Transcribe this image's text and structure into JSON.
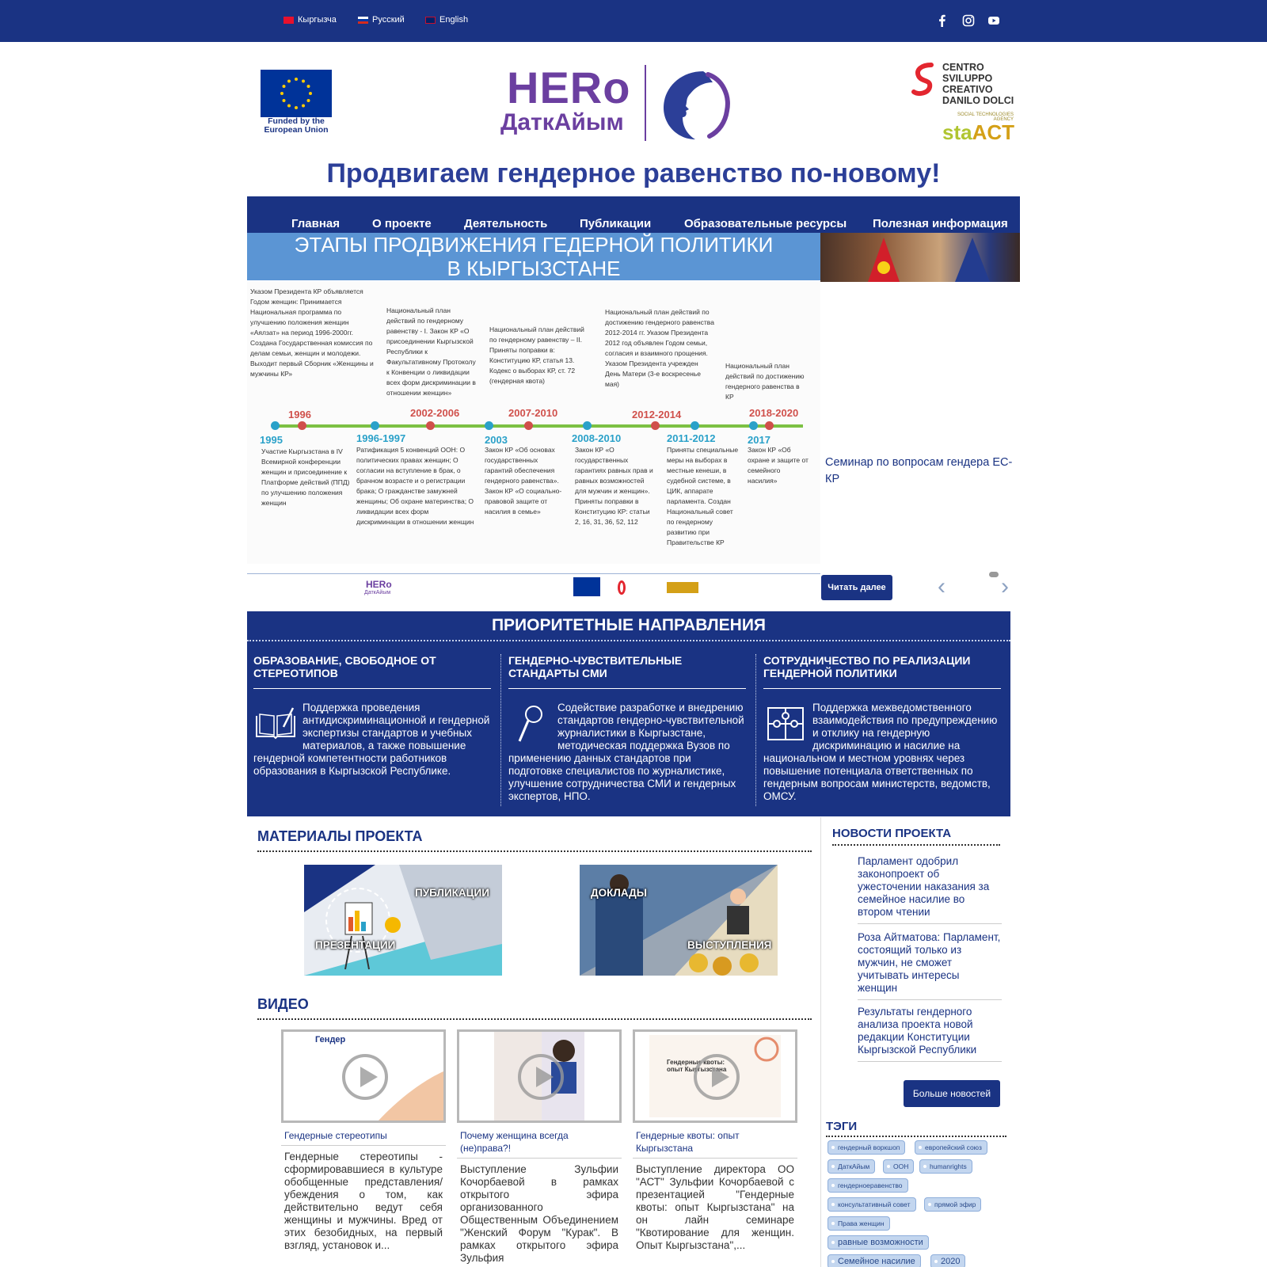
{
  "topbar": {
    "languages": [
      "Кыргызча",
      "Русский",
      "English"
    ],
    "social_icons": [
      "facebook-icon",
      "instagram-icon",
      "youtube-icon"
    ]
  },
  "logos": {
    "eu_caption": "Funded by the European Union",
    "hero_title": "HERo",
    "hero_subtitle": "ДаткАйым",
    "csd_text": "CENTRO SVILUPPO CREATIVO DANILO DOLCI",
    "sta_tagline": "SOCIAL TECHNOLOGIES AGENCY",
    "sta_word_a": "sta",
    "sta_word_b": "ACT"
  },
  "slogan": "Продвигаем гендерное равенство по-новому!",
  "nav": [
    "Главная",
    "О проекте",
    "Деятельность",
    "Публикации",
    "Образовательные ресурсы",
    "Полезная информация"
  ],
  "slider": {
    "heading_line1": "ЭТАПЫ ПРОДВИЖЕНИЯ ГЕДЕРНОЙ ПОЛИТИКИ",
    "heading_line2": "В КЫРГЫЗСТАНЕ",
    "timeline_top": [
      {
        "year": "1996",
        "text": "Указом Президента КР объявляется Годом женщин: Принимается Национальная программа по улучшению положения женщин «Аялзат» на период 1996-2000гг. Создана Государственная комиссия по делам семьи, женщин и молодежи. Выходит первый Сборник «Женщины и мужчины КР»"
      },
      {
        "year": "2002-2006",
        "text": "Национальный план действий по гендерному равенству - I. Закон КР «О присоединении Кыргызской Республики к Факультативному Протоколу к Конвенции о ликвидации всех форм дискриминации в отношении женщин»"
      },
      {
        "year": "2007-2010",
        "text": "Национальный план действий по гендерному равенству – II. Приняты поправки в: Конституцию КР, статья 13. Кодекс о выборах КР, ст. 72 (гендерная квота)"
      },
      {
        "year": "2012-2014",
        "text": "Национальный план действий по достижению гендерного равенства 2012-2014 гг. Указом Президента 2012 год объявлен Годом семьи, согласия и взаимного прощения. Указом Президента учрежден День Матери (3-е воскресенье мая)"
      },
      {
        "year": "2018-2020",
        "text": "Национальный план действий по достижению гендерного равенства в КР"
      }
    ],
    "timeline_bottom": [
      {
        "year": "1995",
        "text": "Участие Кыргызстана в IV Всемирной конференции женщин и присоединение к Платформе действий (ППД) по улучшению положения женщин"
      },
      {
        "year": "1996-1997",
        "text": "Ратификация 5 конвенций ООН: О политических правах женщин; О согласии на вступление в брак, о брачном возрасте и о регистрации брака; О гражданстве замужней женщины; Об охране материнства; О ликвидации всех форм дискриминации в отношении женщин"
      },
      {
        "year": "2003",
        "text": "Закон КР «Об основах государственных гарантий обеспечения гендерного равенства». Закон КР «О социально-правовой защите от насилия в семье»"
      },
      {
        "year": "2008-2010",
        "text": "Закон КР «О государственных гарантиях равных прав и равных возможностей для мужчин и женщин». Приняты поправки в Конституцию КР: статьи 2, 16, 31, 36, 52, 112"
      },
      {
        "year": "2011-2012",
        "text": "Приняты специальные меры на выборах в местные кенеши, в судебной системе, в ЦИК, аппарате парламента. Создан Национальный совет по гендерному развитию при Правительстве КР"
      },
      {
        "year": "2017",
        "text": "Закон КР «Об охране и защите от семейного насилия»"
      }
    ],
    "footer_hero": "HERo",
    "footer_hero_sub": "ДаткАйым",
    "caption": "Семинар по вопросам гендера ЕС-КР",
    "read_more": "Читать далее",
    "prev_arrow": "‹",
    "next_arrow": "›"
  },
  "priorities": {
    "title": "ПРИОРИТЕТНЫЕ НАПРАВЛЕНИЯ",
    "columns": [
      {
        "heading": "ОБРАЗОВАНИЕ, СВОБОДНОЕ ОТ СТЕРЕОТИПОВ",
        "text": "Поддержка проведения антидискриминационной и гендерной экспертизы стандартов и учебных материалов, а также повышение гендерной компетентности работников образования в Кыргызской Республике.",
        "icon": "book-pen-icon"
      },
      {
        "heading": "ГЕНДЕРНО-ЧУВСТВИТЕЛЬНЫЕ СТАНДАРТЫ СМИ",
        "text": "Содействие разработке и внедрению стандартов гендерно-чувствительной журналистики в Кыргызстане, методическая поддержка Вузов по применению данных стандартов при подготовке специалистов по журналистике, улучшение сотрудничества СМИ и гендерных экспертов, НПО.",
        "icon": "microphone-icon"
      },
      {
        "heading": "СОТРУДНИЧЕСТВО ПО РЕАЛИЗАЦИИ ГЕНДЕРНОЙ ПОЛИТИКИ",
        "text": "Поддержка межведомственного взаимодействия по предупреждению и отклику на гендерную дискриминацию и насилие на национальном и местном уровнях через повышение потенциала ответственных по гендерным вопросам министерств, ведомств, ОМСУ.",
        "icon": "puzzle-icon"
      }
    ]
  },
  "materials": {
    "title": "МАТЕРИАЛЫ ПРОЕКТА",
    "cards": [
      {
        "label_a": "ПУБЛИКАЦИИ",
        "label_b": "ПРЕЗЕНТАЦИИ"
      },
      {
        "label_a": "ДОКЛАДЫ",
        "label_b": "ВЫСТУПЛЕНИЯ"
      }
    ]
  },
  "video": {
    "title": "ВИДЕО",
    "items": [
      {
        "thumb_text": "Гендер",
        "title": "Гендерные стереотипы",
        "text": "Гендерные стереотипы - сформировавшиеся в культуре обобщенные представления/убеждения о том, как действительно ведут себя женщины и мужчины. Вред от этих безобидных, на первый взгляд, установок и..."
      },
      {
        "thumb_text": "",
        "title": "Почему женщина всегда (не)права?!",
        "text": "Выступление Зульфии Кочорбаевой в рамках открытого эфира организованного Общественным Объединением \"Женский Форум \"Курак\". В рамках открытого эфира Зульфия"
      },
      {
        "thumb_text": "Гендерные квоты: опыт Кыргызстана",
        "title": "Гендерные квоты: опыт Кыргызстана",
        "text": "Выступление директора ОО \"АСТ\" Зульфии Кочорбаевой с презентацией \"Гендерные квоты: опыт Кыргызстана\" на он лайн семинаре \"Квотирование для женщин. Опыт Кыргызстана\",..."
      }
    ]
  },
  "sidebar": {
    "news_title": "НОВОСТИ ПРОЕКТА",
    "news": [
      "Парламент одобрил законопроект об ужесточении наказания за семейное насилие во втором чтении",
      "Роза Айтматова: Парламент, состоящий только из мужчин, не сможет учитывать интересы женщин",
      "Результаты гендерного анализа проекта новой редакции Конституции Кыргызской Республики"
    ],
    "more_news": "Больше новостей",
    "tags_title": "ТЭГИ",
    "tags": [
      "гендерный воркшоп",
      "европейский союз",
      "ДаткАйым",
      "ООН",
      "humanrights",
      "гендерноеравенство",
      "консультативный совет",
      "прямой эфир",
      "Права женщин",
      "равные возможности",
      "Семейное насилие",
      "2020"
    ]
  },
  "colors": {
    "brand_navy": "#1a3383",
    "hero_purple": "#6b3fa0",
    "slide_blue": "#5b95d4",
    "timeline_green": "#7cc143",
    "accent_red": "#d0504b"
  }
}
